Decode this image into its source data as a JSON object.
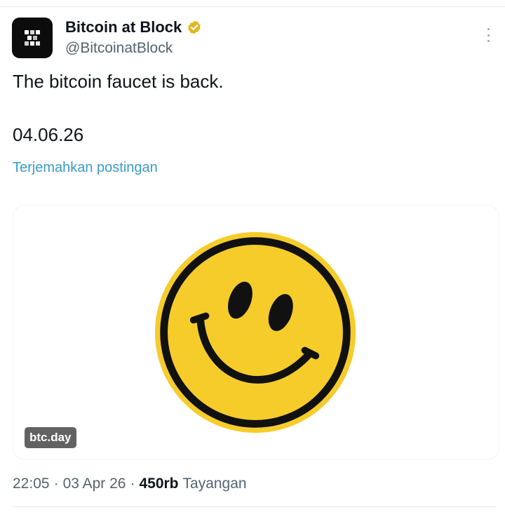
{
  "author": {
    "display_name": "Bitcoin at Block",
    "handle": "@BitcoinatBlock",
    "avatar_icon": "block-logo-icon",
    "verified_icon": "verified-badge-icon",
    "verified_color": "#e2b719"
  },
  "tweet": {
    "text_line1": "The bitcoin faucet is back.",
    "text_line2": "04.06.26",
    "translate_label": "Terjemahkan postingan"
  },
  "media": {
    "image_icon": "smiley-face-icon",
    "domain_label": "btc.day",
    "face_color": "#f6cc2b",
    "outline_color": "#111111"
  },
  "meta": {
    "time": "22:05",
    "separator": "·",
    "date": "03 Apr 26",
    "views_count": "450rb",
    "views_label": "Tayangan"
  },
  "colors": {
    "link": "#3a9bc6",
    "secondary_text": "#536471",
    "primary_text": "#0f1419"
  }
}
